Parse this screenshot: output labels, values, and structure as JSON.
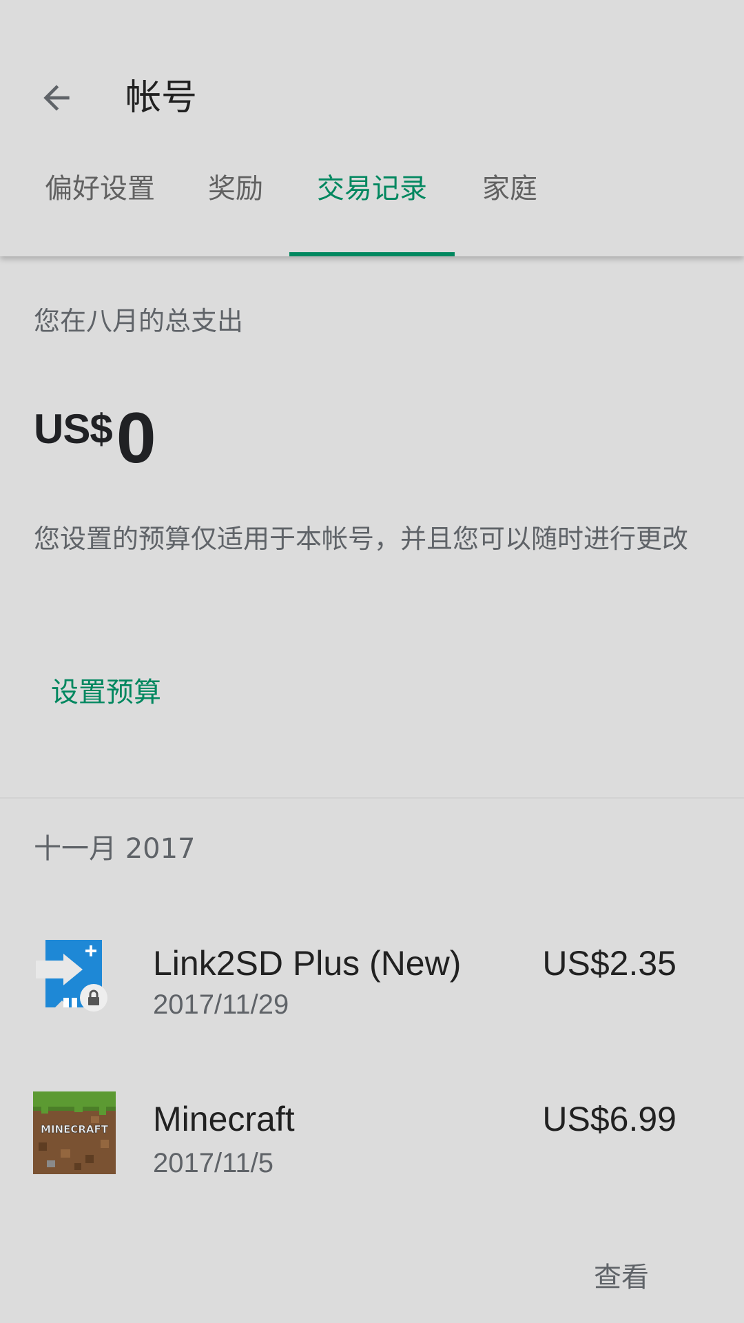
{
  "header": {
    "title": "帐号",
    "back_icon": "arrow-back-icon"
  },
  "tabs": [
    {
      "label": "偏好设置",
      "active": false
    },
    {
      "label": "奖励",
      "active": false
    },
    {
      "label": "交易记录",
      "active": true
    },
    {
      "label": "家庭",
      "active": false
    }
  ],
  "spending": {
    "label": "您在八月的总支出",
    "currency": "US$",
    "amount": "0",
    "note": "您设置的预算仅适用于本帐号，并且您可以随时进行更改",
    "set_budget_label": "设置预算"
  },
  "transactions": {
    "month_header": "十一月 2017",
    "items": [
      {
        "name": "Link2SD Plus (New)",
        "date": "2017/11/29",
        "price": "US$2.35",
        "icon": "link2sd-app-icon"
      },
      {
        "name": "Minecraft",
        "date": "2017/11/5",
        "price": "US$6.99",
        "icon": "minecraft-app-icon",
        "icon_text": "MINECRAFT"
      }
    ],
    "view_label": "查看"
  },
  "colors": {
    "accent": "#01875f",
    "background": "#dcdcdc",
    "primary_text": "#212121",
    "secondary_text": "#5f6368"
  }
}
